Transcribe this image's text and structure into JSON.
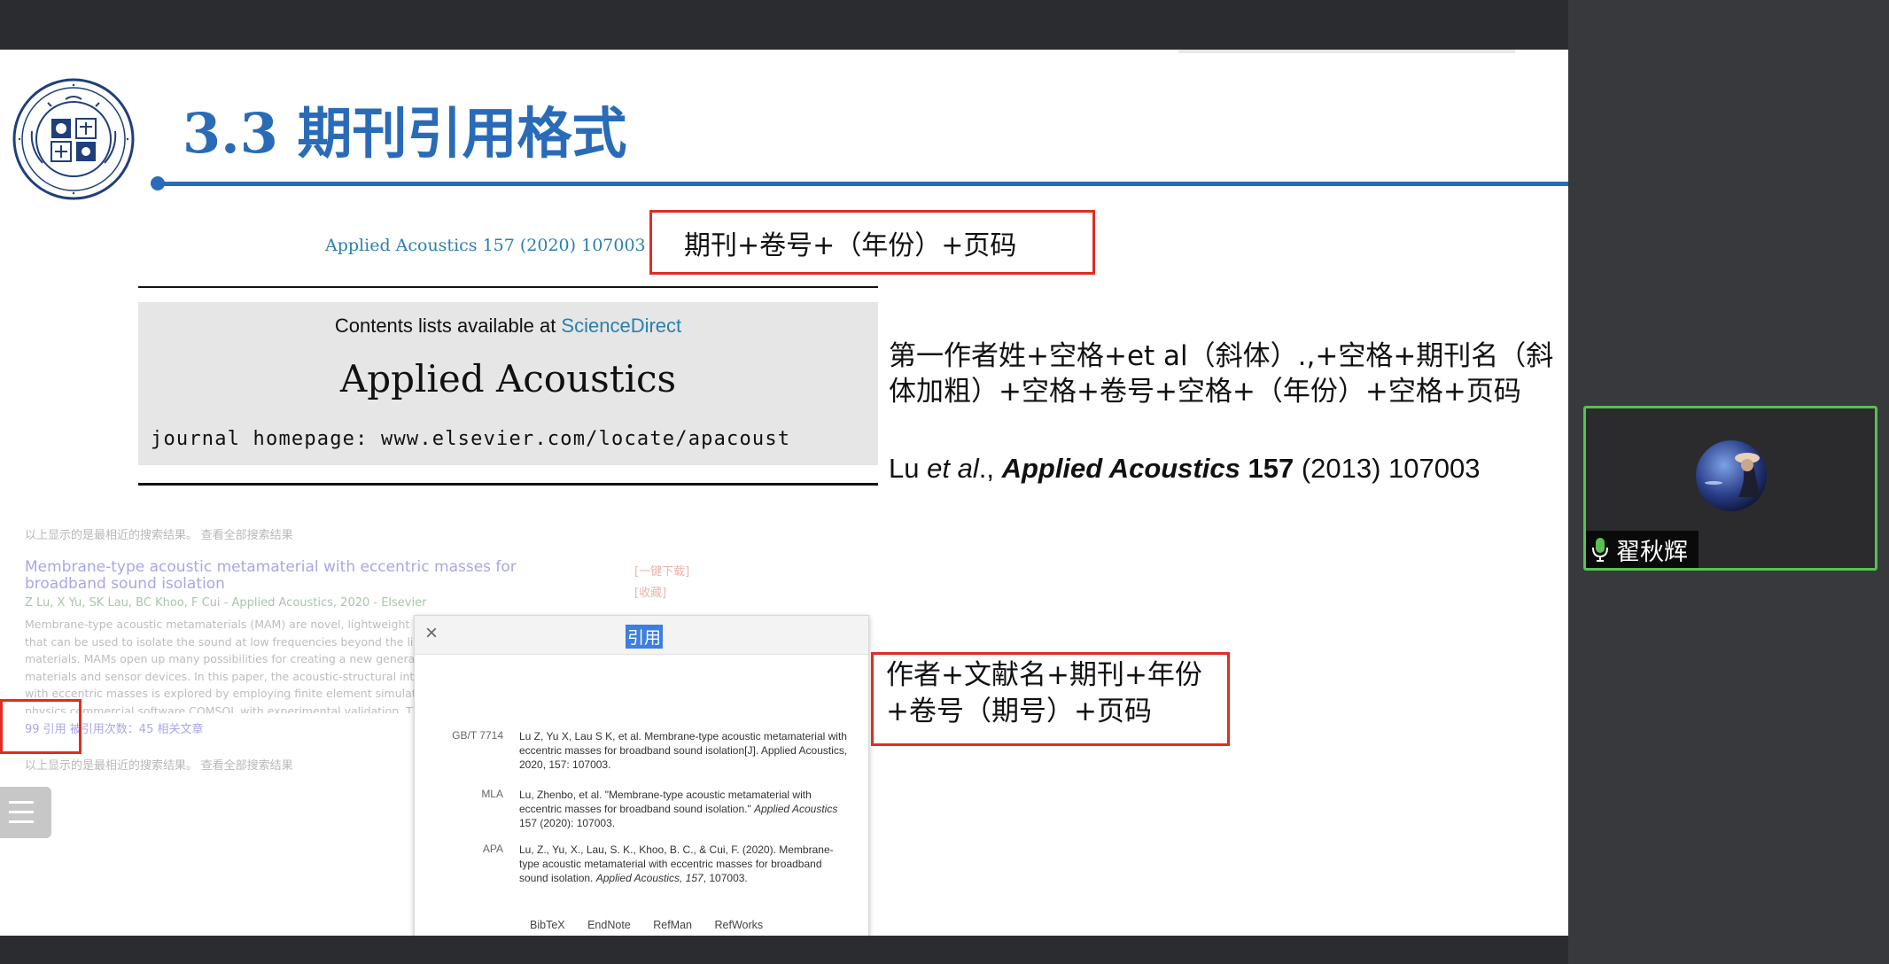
{
  "slide": {
    "title": "3.3 期刊引用格式",
    "journal_header": {
      "citation": "Applied Acoustics 157 (2020) 107003",
      "contents_prefix": "Contents lists available at ",
      "contents_link": "ScienceDirect",
      "journal_name": "Applied Acoustics",
      "homepage": "journal homepage: www.elsevier.com/locate/apacoust"
    },
    "annotations": {
      "journal_format": "期刊+卷号+（年份）+页码",
      "citation_format": [
        "作者+文献名+期刊+年份",
        "+卷号（期号）+页码"
      ],
      "format_description": "第一作者姓+空格+et al（斜体）.,+空格+期刊名（斜体加粗）+空格+卷号+空格+（年份）+空格+页码",
      "example": {
        "author": "Lu ",
        "etal": "et al",
        "sep": "., ",
        "journal": "Applied Acoustics",
        "volume": " 157",
        "rest": " (2013) 107003"
      }
    },
    "scholar": {
      "note_top": "以上显示的是最相近的搜索结果。 查看全部搜索结果",
      "note_bottom": "以上显示的是最相近的搜索结果。 查看全部搜索结果",
      "result_title": "Membrane-type acoustic metamaterial with eccentric masses for broadband sound isolation",
      "authors": "Z Lu, X Yu, SK Lau, BC Khoo, F Cui - Applied Acoustics, 2020 - Elsevier",
      "snippet": [
        "Membrane-type acoustic metamaterials (MAM) are novel, lightweight and co",
        "that can be used to isolate the sound at low frequencies beyond the limits of",
        "materials. MAMs open up many possibilities for creating a new generation of",
        "materials and sensor devices. In this paper, the acoustic-structural interactio",
        "with eccentric masses is explored by employing finite element simulations tha",
        "physics commercial software COMSOL with experimental validation. This sc"
      ],
      "actions": "99  引用   被引用次数：45    相关文章",
      "side_links": [
        "[一键下载]",
        "[收藏]"
      ]
    },
    "cite_popup": {
      "close": "×",
      "title": "引用",
      "rows": [
        {
          "label": "GB/T 7714",
          "text": "Lu Z, Yu X, Lau S K, et al. Membrane-type acoustic metamaterial with eccentric masses for broadband sound isolation[J]. Applied Acoustics, 2020, 157: 107003."
        },
        {
          "label": "MLA",
          "text_pre": "Lu, Zhenbo, et al. \"Membrane-type acoustic metamaterial with eccentric masses for broadband sound isolation.\" ",
          "text_it": "Applied Acoustics",
          "text_post": " 157 (2020): 107003."
        },
        {
          "label": "APA",
          "text_pre": "Lu, Z., Yu, X., Lau, S. K., Khoo, B. C., & Cui, F. (2020). Membrane-type acoustic metamaterial with eccentric masses for broadband sound isolation. ",
          "text_it": "Applied Acoustics, 157",
          "text_post": ", 107003."
        }
      ],
      "exports": [
        "BibTeX",
        "EndNote",
        "RefMan",
        "RefWorks"
      ]
    }
  },
  "participant": {
    "name": "翟秋辉"
  },
  "colors": {
    "accent_blue": "#2a6bb8",
    "annotation_red": "#e02c21",
    "speaking_green": "#59c053"
  },
  "icons": [
    "university-seal-logo",
    "close-icon",
    "list-menu-icon",
    "microphone-icon",
    "avatar-image"
  ]
}
